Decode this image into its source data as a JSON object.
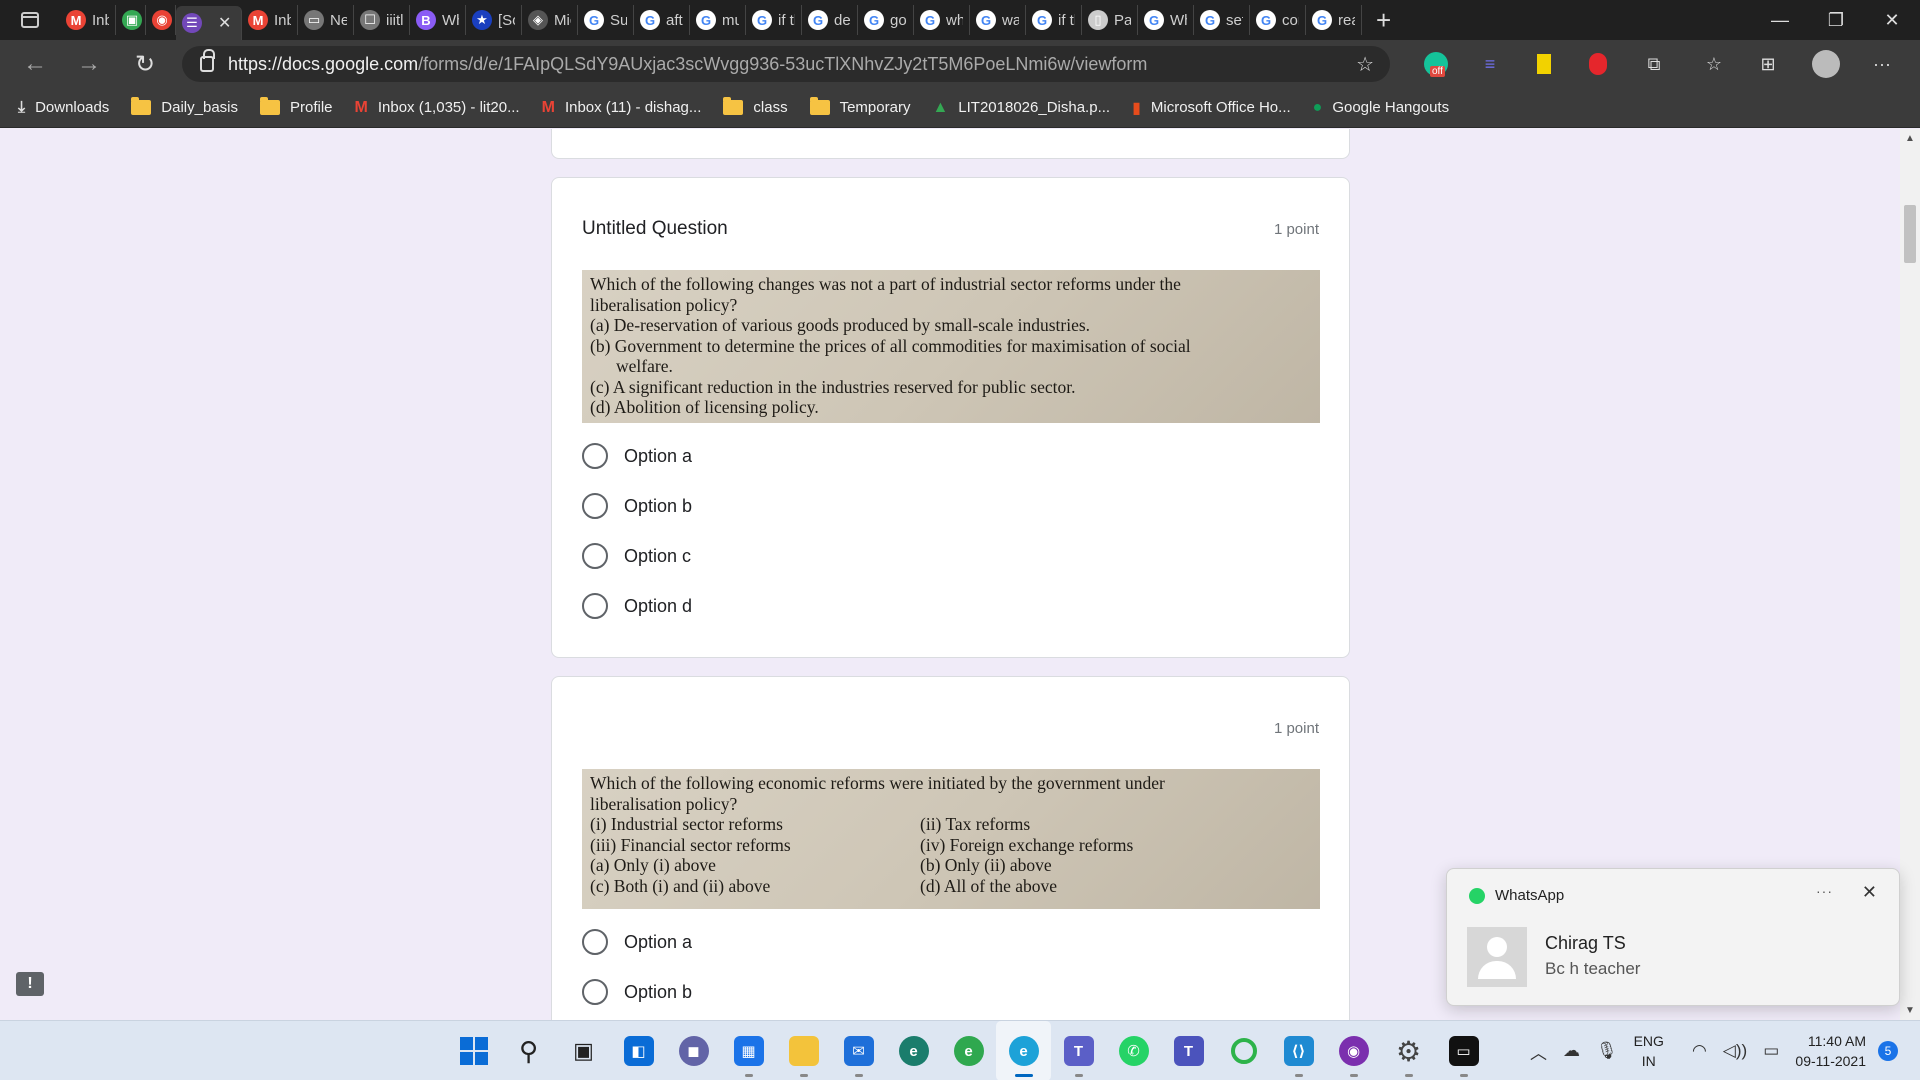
{
  "browser": {
    "tabs": [
      {
        "label": "Inb",
        "icon": "gmail-icon",
        "color": "#ea4335",
        "glyph": "M"
      },
      {
        "label": "",
        "icon": "meet-icon",
        "color": "#34a853",
        "glyph": "▣"
      },
      {
        "label": "",
        "icon": "record-icon",
        "color": "#e94235",
        "glyph": "◉"
      },
      {
        "label": "",
        "icon": "forms-icon",
        "color": "#7248b9",
        "glyph": "☰",
        "active": true
      },
      {
        "label": "Inb",
        "icon": "gmail-icon",
        "color": "#ea4335",
        "glyph": "M"
      },
      {
        "label": "Ne",
        "icon": "newtab-icon",
        "color": "#777777",
        "glyph": "▭"
      },
      {
        "label": "iiitl",
        "icon": "page-icon",
        "color": "#777777",
        "glyph": "☐"
      },
      {
        "label": "Wh",
        "icon": "bookmark-app-icon",
        "color": "#8a5cf5",
        "glyph": "B"
      },
      {
        "label": "[Sol",
        "icon": "star-icon",
        "color": "#1a3fbf",
        "glyph": "★"
      },
      {
        "label": "Mic",
        "icon": "diamond-icon",
        "color": "#555555",
        "glyph": "◈"
      },
      {
        "label": "Sun",
        "icon": "google-icon",
        "color": "#ffffff",
        "glyph": "G"
      },
      {
        "label": "afte",
        "icon": "google-icon",
        "color": "#ffffff",
        "glyph": "G"
      },
      {
        "label": "mu",
        "icon": "google-icon",
        "color": "#ffffff",
        "glyph": "G"
      },
      {
        "label": "if tl",
        "icon": "google-icon",
        "color": "#ffffff",
        "glyph": "G"
      },
      {
        "label": "der",
        "icon": "google-icon",
        "color": "#ffffff",
        "glyph": "G"
      },
      {
        "label": "goc",
        "icon": "google-icon",
        "color": "#ffffff",
        "glyph": "G"
      },
      {
        "label": "wh",
        "icon": "google-icon",
        "color": "#ffffff",
        "glyph": "G"
      },
      {
        "label": "wa",
        "icon": "google-icon",
        "color": "#ffffff",
        "glyph": "G"
      },
      {
        "label": "if tl",
        "icon": "google-icon",
        "color": "#ffffff",
        "glyph": "G"
      },
      {
        "label": "Pap",
        "icon": "document-icon",
        "color": "#cccccc",
        "glyph": "▯"
      },
      {
        "label": "Wh",
        "icon": "google-icon",
        "color": "#ffffff",
        "glyph": "G"
      },
      {
        "label": "set",
        "icon": "google-icon",
        "color": "#ffffff",
        "glyph": "G"
      },
      {
        "label": "cor",
        "icon": "google-icon",
        "color": "#ffffff",
        "glyph": "G"
      },
      {
        "label": "rea",
        "icon": "google-icon",
        "color": "#ffffff",
        "glyph": "G"
      }
    ],
    "url_host": "https://docs.google.com",
    "url_path": "/forms/d/e/1FAIpQLSdY9AUxjac3scWvgg936-53ucTlXNhvZJy2tT5M6PoeLNmi6w/viewform",
    "extension_badge": "off"
  },
  "bookmarks": [
    {
      "label": "Downloads",
      "icon": "download-icon"
    },
    {
      "label": "Daily_basis",
      "icon": "folder-icon"
    },
    {
      "label": "Profile",
      "icon": "folder-icon"
    },
    {
      "label": "Inbox (1,035) - lit20...",
      "icon": "gmail-icon"
    },
    {
      "label": "Inbox (11) - dishag...",
      "icon": "gmail-icon"
    },
    {
      "label": "class",
      "icon": "folder-icon"
    },
    {
      "label": "Temporary",
      "icon": "folder-icon"
    },
    {
      "label": "LIT2018026_Disha.p...",
      "icon": "drive-icon"
    },
    {
      "label": "Microsoft Office Ho...",
      "icon": "office-icon"
    },
    {
      "label": "Google Hangouts",
      "icon": "hangouts-icon"
    }
  ],
  "form": {
    "questions": [
      {
        "title": "Untitled Question",
        "points": "1 point",
        "image_text": {
          "stem": "Which of the following changes was not a part of industrial sector reforms under the",
          "stem2": "liberalisation policy?",
          "a": "(a)  De-reservation of various goods produced by small-scale industries.",
          "b": "(b)  Government to determine the prices of all commodities for maximisation of social",
          "b2": "welfare.",
          "c": "(c)  A significant reduction in the industries reserved for public sector.",
          "d": "(d)  Abolition of licensing policy."
        },
        "options": [
          "Option a",
          "Option b",
          "Option c",
          "Option d"
        ]
      },
      {
        "title": "",
        "points": "1 point",
        "image_text": {
          "stem": "Which of the following economic reforms were initiated by the government under",
          "stem2": "liberalisation policy?",
          "i": "(i)  Industrial sector reforms",
          "ii": "(ii)  Tax reforms",
          "iii": "(iii)  Financial sector reforms",
          "iv": "(iv)  Foreign exchange reforms",
          "a": "(a)  Only (i) above",
          "b": "(b)  Only (ii) above",
          "c": "(c)  Both (i) and (ii) above",
          "d": "(d)  All of the above"
        },
        "options": [
          "Option a",
          "Option b"
        ]
      }
    ]
  },
  "notification": {
    "app": "WhatsApp",
    "sender": "Chirag TS",
    "message": "Bc h teacher"
  },
  "taskbar": {
    "language": "ENG",
    "region": "IN",
    "time": "11:40 AM",
    "date": "09-11-2021",
    "notification_count": "5"
  }
}
